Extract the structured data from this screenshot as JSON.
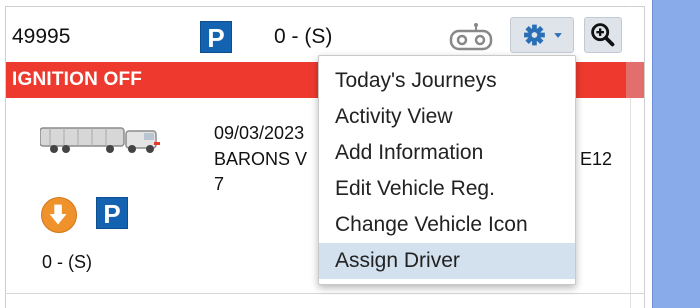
{
  "vehicle": {
    "id": "49995",
    "status": "0 - (S)",
    "parked_icon_label": "P",
    "ignition_text": "IGNITION OFF",
    "timestamp": "09/03/2023",
    "location_start": "BARONS V",
    "location_tail": "E12",
    "location_line2": "7",
    "status_lower": "0 - (S)"
  },
  "colors": {
    "ignition_bar": "#ee3a2e",
    "park_badge": "#1463b0",
    "down_circle": "#f0922b",
    "menu_highlight": "#d3e1ee",
    "side_panel": "#8aabe9"
  },
  "toolbar": {
    "tracker_icon": "tracker-icon",
    "gear_icon": "gear-icon",
    "zoom_icon": "zoom-in-icon"
  },
  "menu": {
    "items": [
      {
        "label": "Today's Journeys"
      },
      {
        "label": "Activity View"
      },
      {
        "label": "Add Information"
      },
      {
        "label": "Edit Vehicle Reg."
      },
      {
        "label": "Change Vehicle Icon"
      },
      {
        "label": "Assign Driver",
        "highlighted": true
      }
    ]
  }
}
